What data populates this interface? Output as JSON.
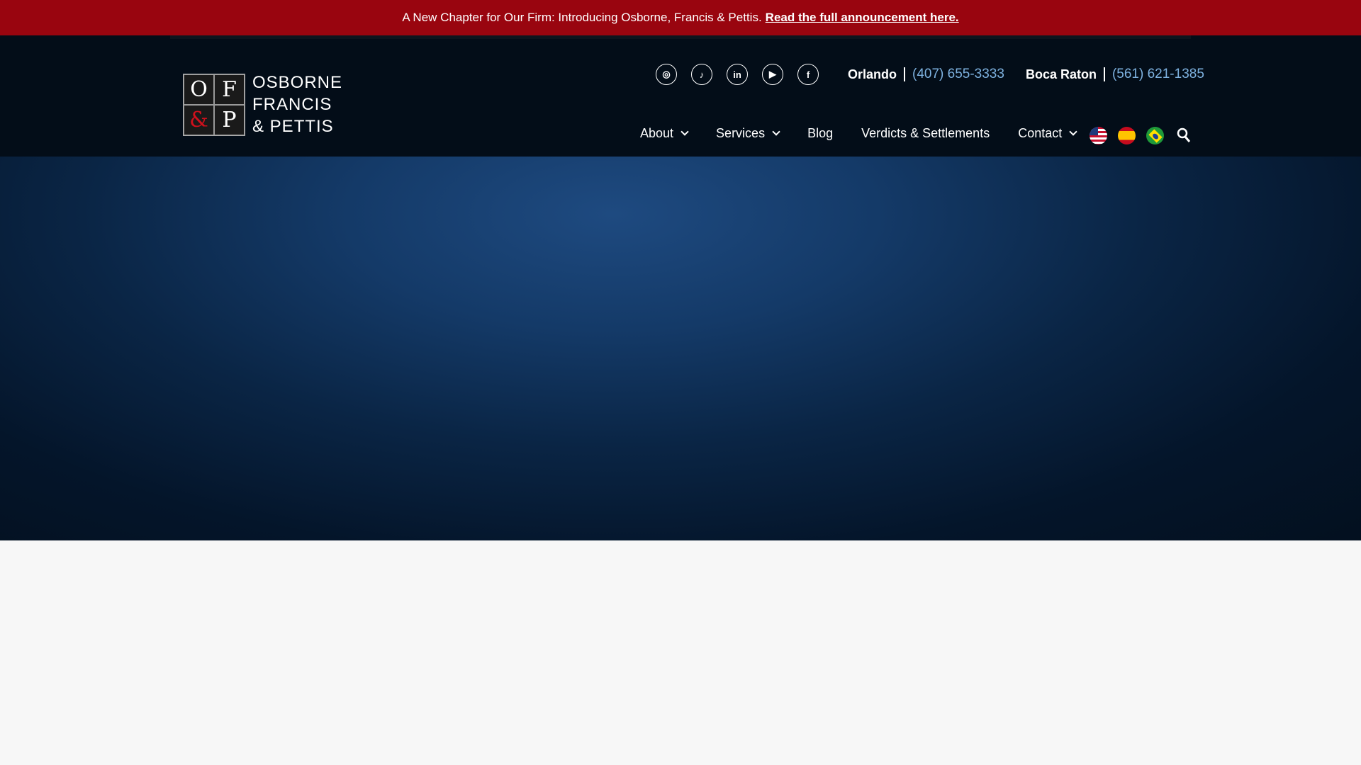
{
  "banner": {
    "text": "A New Chapter for Our Firm: Introducing Osborne, Francis & Pettis.",
    "link": "Read the full announcement here."
  },
  "logo": {
    "letters": [
      "O",
      "F",
      "&",
      "P"
    ],
    "lines": [
      "OSBORNE",
      "FRANCIS",
      "& PETTIS"
    ]
  },
  "social": [
    {
      "icon": "instagram-icon",
      "glyph": "◎"
    },
    {
      "icon": "tiktok-icon",
      "glyph": "♪"
    },
    {
      "icon": "linkedin-icon",
      "glyph": "in"
    },
    {
      "icon": "youtube-icon",
      "glyph": "▶"
    },
    {
      "icon": "facebook-icon",
      "glyph": "f"
    }
  ],
  "contacts": [
    {
      "city": "Orlando",
      "phone": "(407) 655-3333"
    },
    {
      "city": "Boca Raton",
      "phone": "(561) 621-1385"
    }
  ],
  "nav": [
    {
      "label": "About"
    },
    {
      "label": "Services"
    },
    {
      "label": "Blog"
    },
    {
      "label": "Verdicts & Settlements"
    },
    {
      "label": "Contact"
    }
  ],
  "languages": [
    "English",
    "Español",
    "Português"
  ],
  "colors": {
    "banner": "#99050f",
    "header": "#030d18",
    "phone": "#7eb2e0"
  }
}
